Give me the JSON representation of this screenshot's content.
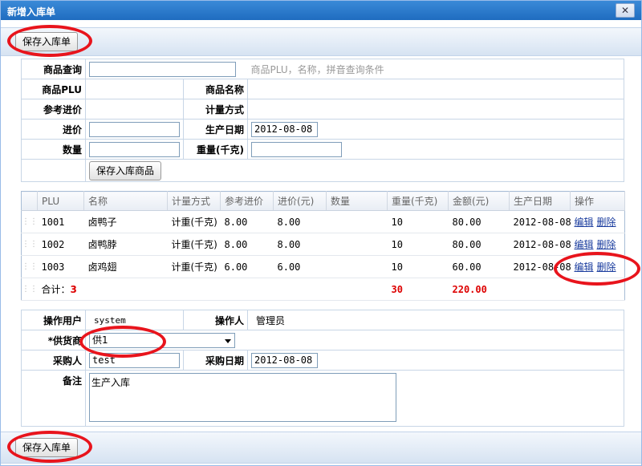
{
  "window": {
    "title": "新增入库单",
    "close_glyph": "✕"
  },
  "toolbar": {
    "save_label": "保存入库单"
  },
  "product_form": {
    "query_label": "商品查询",
    "query_value": "",
    "query_hint": "商品PLU，名称，拼音查询条件",
    "plu_label": "商品PLU",
    "plu_value": "",
    "name_label": "商品名称",
    "name_value": "",
    "ref_price_label": "参考进价",
    "ref_price_value": "",
    "measure_label": "计量方式",
    "measure_value": "",
    "price_label": "进价",
    "price_value": "",
    "date_label": "生产日期",
    "date_value": "2012-08-08",
    "qty_label": "数量",
    "qty_value": "",
    "weight_label": "重量(千克)",
    "weight_value": "",
    "save_item_label": "保存入库商品"
  },
  "grid": {
    "headers": [
      "PLU",
      "名称",
      "计量方式",
      "参考进价",
      "进价(元)",
      "数量",
      "重量(千克)",
      "金额(元)",
      "生产日期",
      "操作"
    ],
    "rows": [
      {
        "plu": "1001",
        "name": "卤鸭子",
        "measure": "计重(千克)",
        "ref_price": "8.00",
        "price": "8.00",
        "qty": "",
        "weight": "10",
        "amount": "80.00",
        "date": "2012-08-08",
        "edit": "编辑",
        "delete": "删除"
      },
      {
        "plu": "1002",
        "name": "卤鸭脖",
        "measure": "计重(千克)",
        "ref_price": "8.00",
        "price": "8.00",
        "qty": "",
        "weight": "10",
        "amount": "80.00",
        "date": "2012-08-08",
        "edit": "编辑",
        "delete": "删除"
      },
      {
        "plu": "1003",
        "name": "卤鸡翅",
        "measure": "计重(千克)",
        "ref_price": "6.00",
        "price": "6.00",
        "qty": "",
        "weight": "10",
        "amount": "60.00",
        "date": "2012-08-08",
        "edit": "编辑",
        "delete": "删除"
      }
    ],
    "summary": {
      "label": "合计：",
      "count": "3",
      "weight_total": "30",
      "amount_total": "220.00"
    }
  },
  "order_form": {
    "user_label": "操作用户",
    "user_value": "system",
    "operator_label": "操作人",
    "operator_value": "管理员",
    "supplier_label": "*供货商",
    "supplier_value": "供1",
    "buyer_label": "采购人",
    "buyer_value": "test",
    "purchase_date_label": "采购日期",
    "purchase_date_value": "2012-08-08",
    "note_label": "备注",
    "note_value": "生产入库"
  },
  "colors": {
    "title_bar": "#2a7bd0",
    "highlight": "#e8141c",
    "total_red": "#dd0000",
    "link": "#1a3c9e"
  }
}
